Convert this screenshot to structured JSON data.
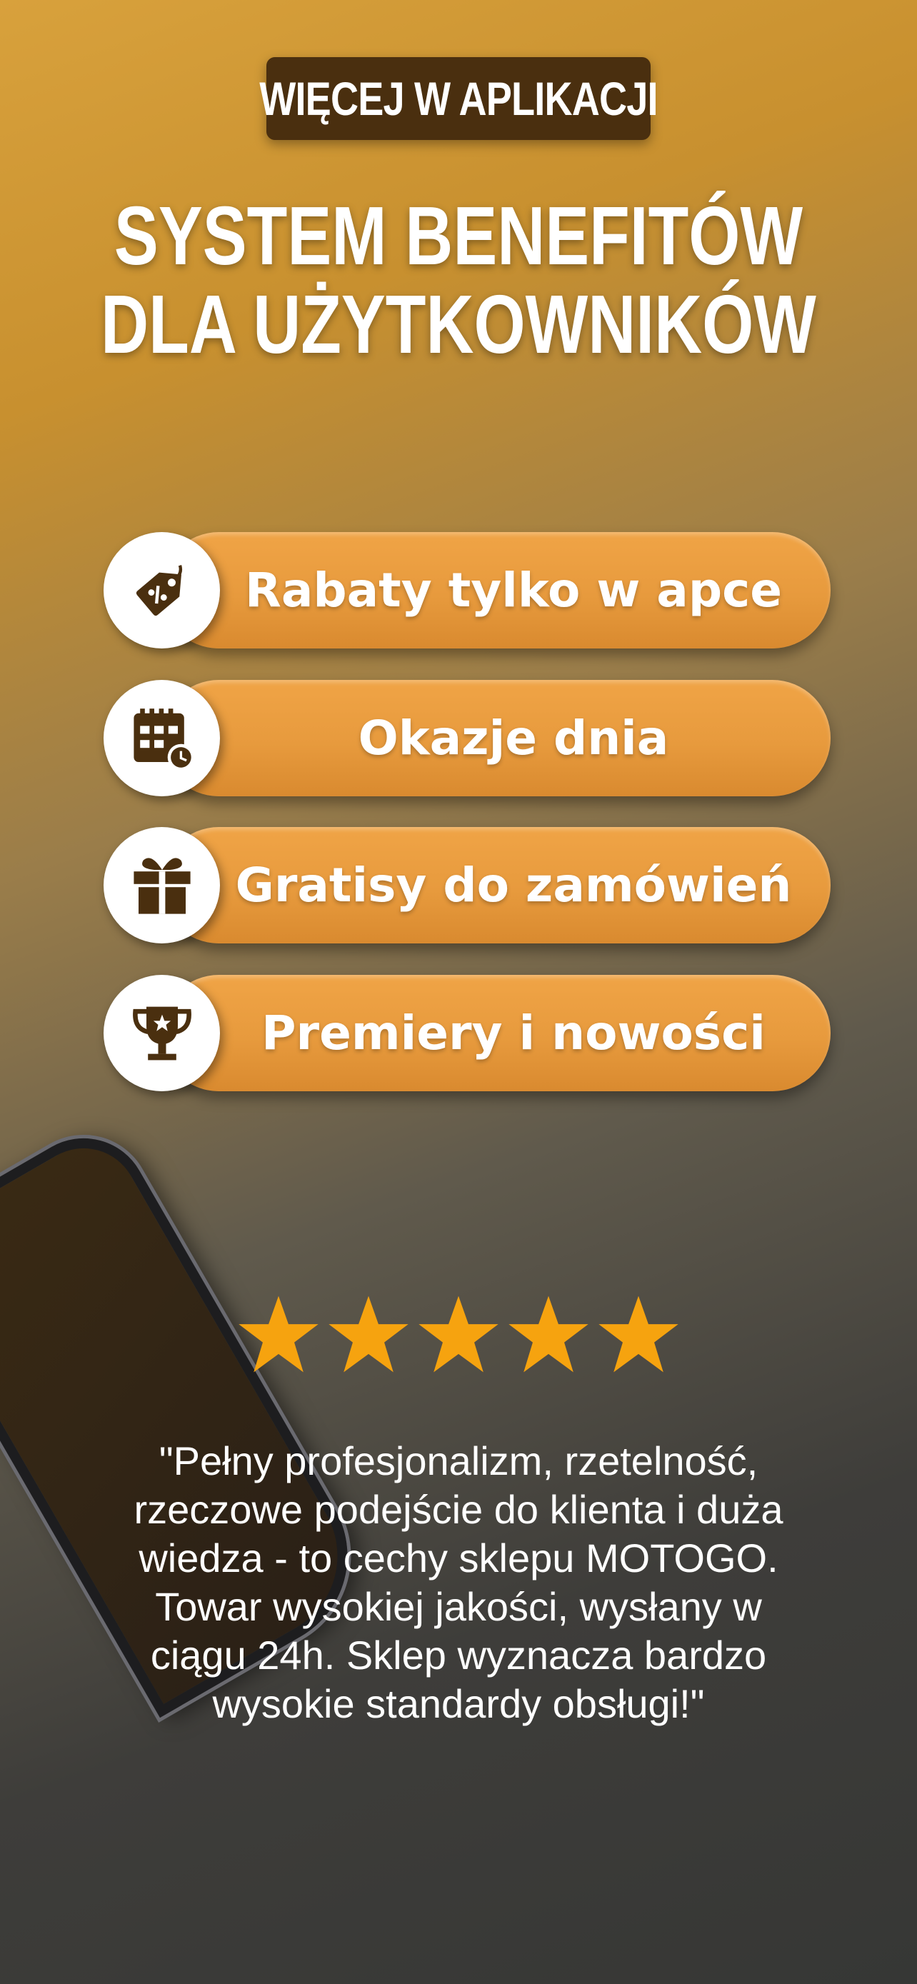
{
  "badge": {
    "label": "WIĘCEJ W APLIKACJI"
  },
  "headline": {
    "line1": "SYSTEM BENEFITÓW",
    "line2": "DLA UŻYTKOWNIKÓW"
  },
  "benefits": [
    {
      "label": "Rabaty tylko w apce",
      "icon": "discount-tag-icon"
    },
    {
      "label": "Okazje dnia",
      "icon": "calendar-clock-icon"
    },
    {
      "label": "Gratisy do zamówień",
      "icon": "gift-icon"
    },
    {
      "label": "Premiery i nowości",
      "icon": "trophy-icon"
    }
  ],
  "rating": {
    "stars": 5,
    "max": 5,
    "star_color": "#f6a30f"
  },
  "review": {
    "lines": [
      "\"Pełny profesjonalizm, rzetelność,",
      "rzeczowe podejście do klienta i duża",
      "wiedza - to cechy sklepu MOTOGO.",
      "Towar wysokiej jakości, wysłany w",
      "ciągu 24h. Sklep wyznacza bardzo",
      "wysokie standardy obsługi!\""
    ]
  },
  "colors": {
    "accent": "#e89b3e",
    "badge_bg": "#4a2f0f",
    "icon_color": "#4a2f0f"
  }
}
